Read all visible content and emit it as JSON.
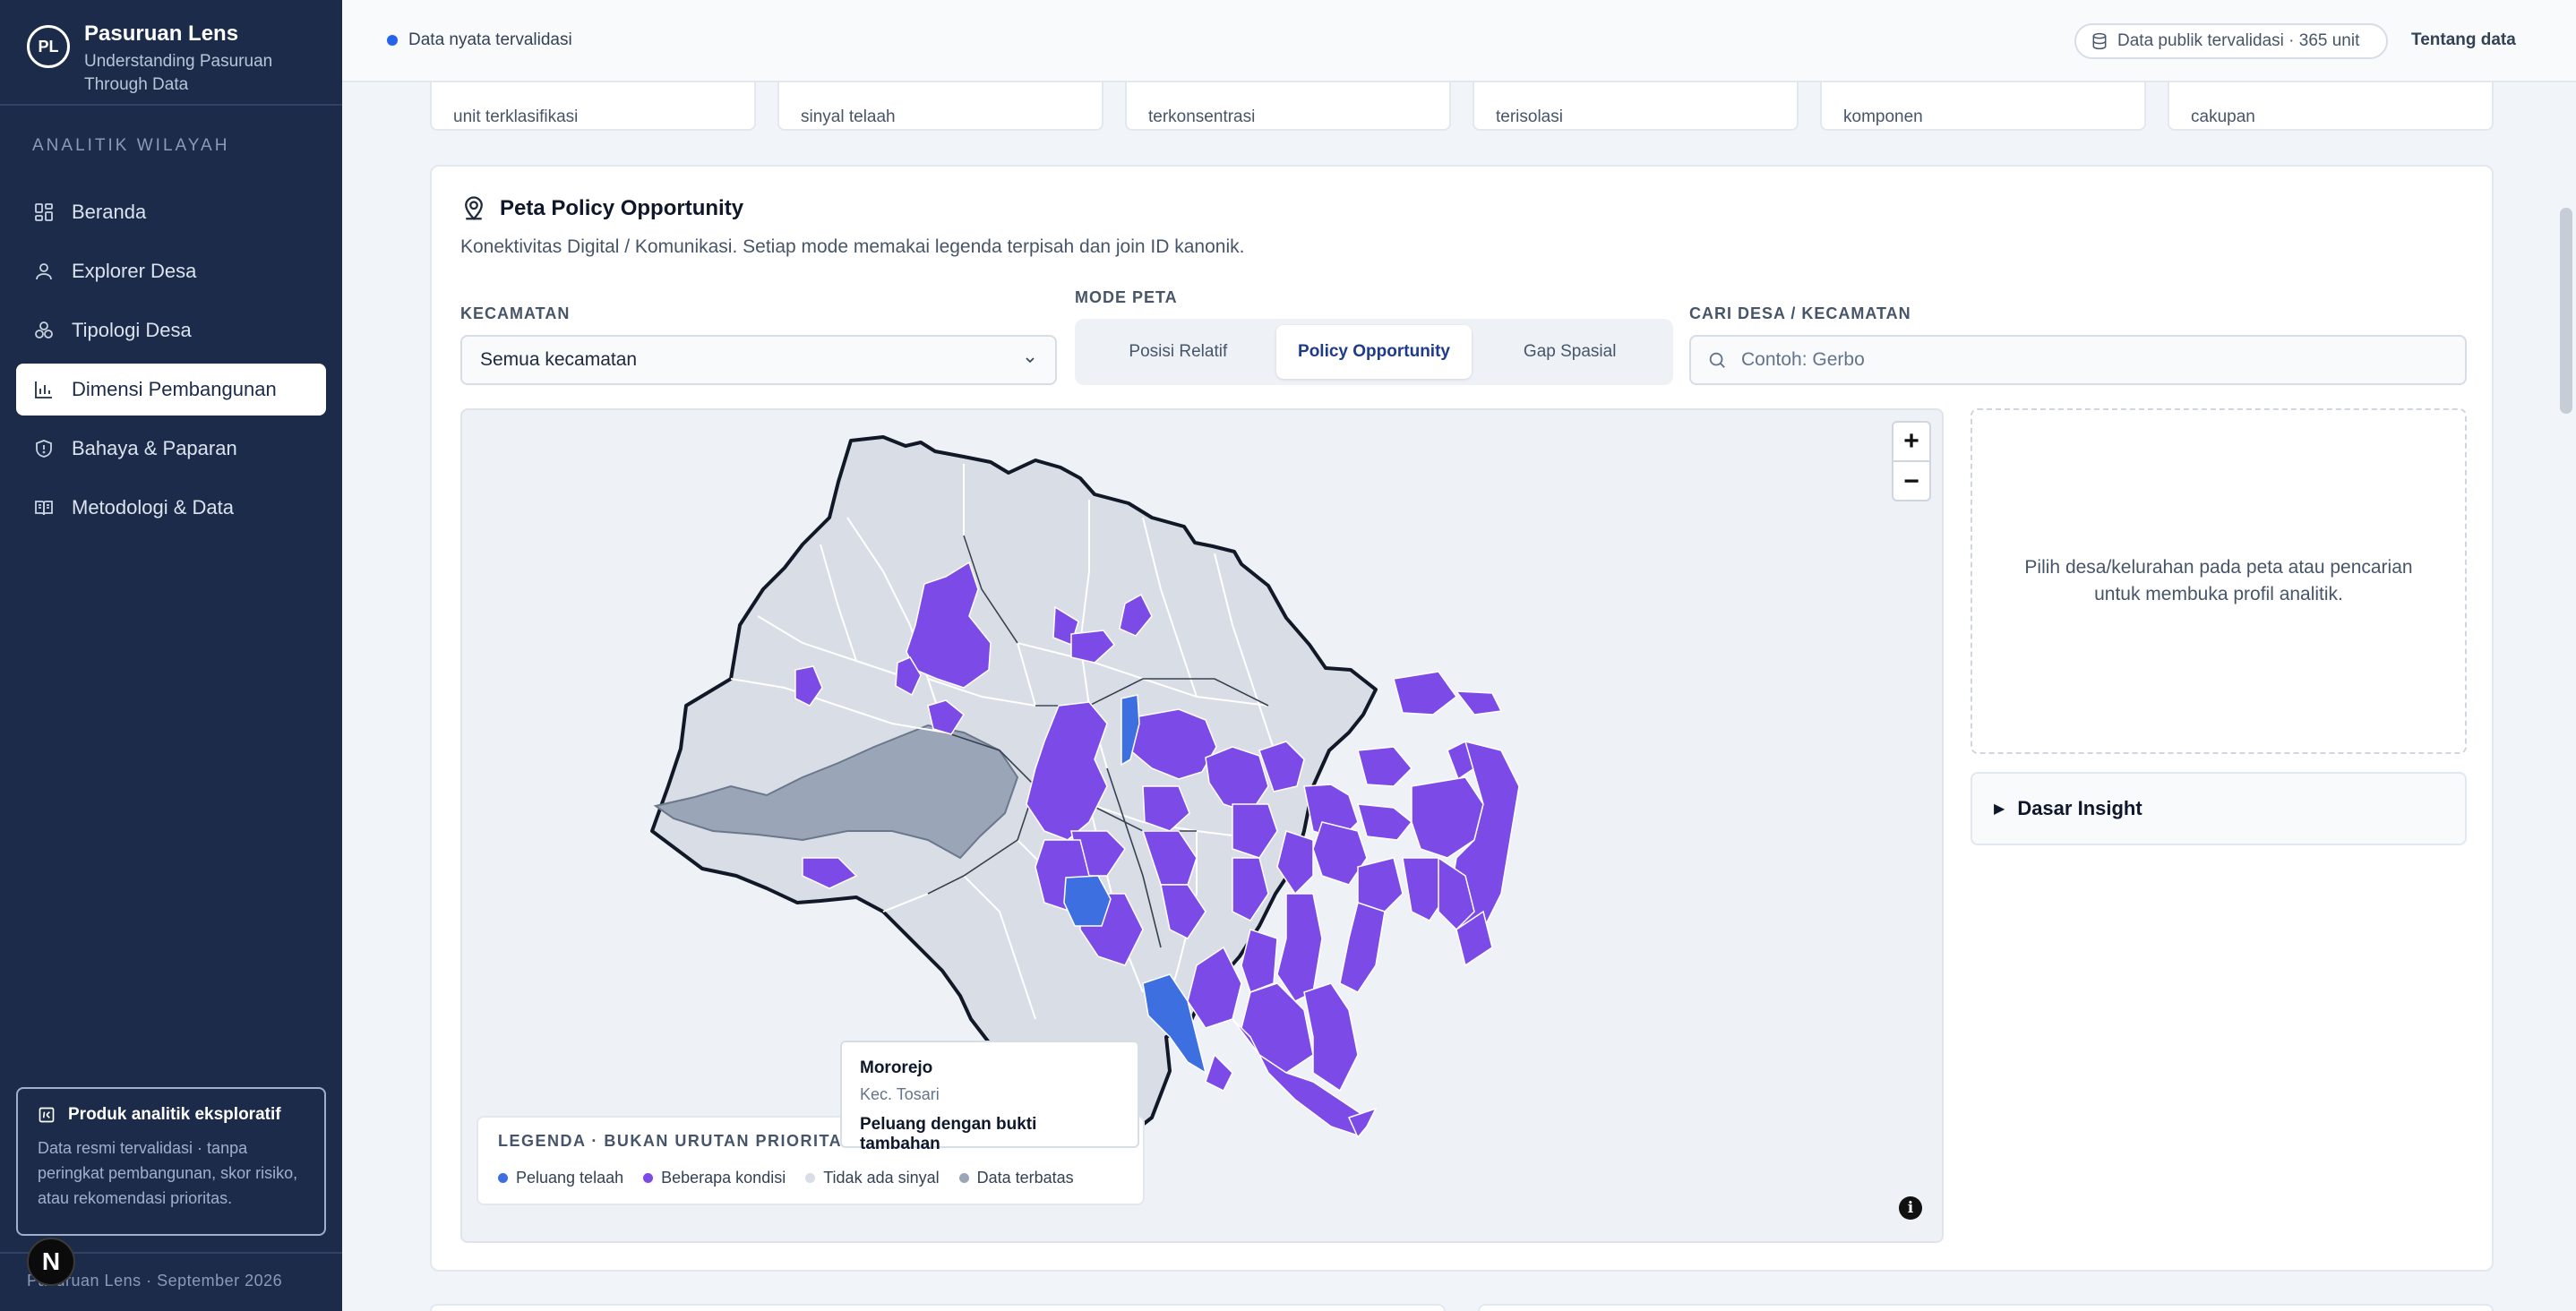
{
  "brand": {
    "logo": "PL",
    "title": "Pasuruan Lens",
    "subtitle": "Understanding Pasuruan Through Data"
  },
  "sidebar": {
    "section_label": "ANALITIK WILAYAH",
    "items": [
      {
        "label": "Beranda",
        "icon": "grid-icon",
        "active": false
      },
      {
        "label": "Explorer Desa",
        "icon": "user-icon",
        "active": false
      },
      {
        "label": "Tipologi Desa",
        "icon": "circles-icon",
        "active": false
      },
      {
        "label": "Dimensi Pembangunan",
        "icon": "bar-chart-icon",
        "active": true
      },
      {
        "label": "Bahaya & Paparan",
        "icon": "shield-icon",
        "active": false
      },
      {
        "label": "Metodologi & Data",
        "icon": "book-icon",
        "active": false
      }
    ],
    "promo": {
      "title": "Produk analitik eksploratif",
      "body": "Data resmi tervalidasi · tanpa peringkat pembangunan, skor risiko, atau rekomendasi prioritas."
    },
    "footer": "Pasuruan Lens · September 2026",
    "badge": "N"
  },
  "topbar": {
    "status": "Data nyata tervalidasi",
    "pill": "Data publik tervalidasi · 365 unit",
    "about": "Tentang data"
  },
  "kpis": [
    "unit terklasifikasi",
    "sinyal telaah",
    "terkonsentrasi",
    "terisolasi",
    "komponen",
    "cakupan"
  ],
  "panel": {
    "title": "Peta Policy Opportunity",
    "description": "Konektivitas Digital / Komunikasi. Setiap mode memakai legenda terpisah dan join ID kanonik.",
    "kecamatan_label": "KECAMATAN",
    "kecamatan_value": "Semua kecamatan",
    "mode_label": "MODE PETA",
    "modes": [
      {
        "label": "Posisi Relatif",
        "active": false
      },
      {
        "label": "Policy Opportunity",
        "active": true
      },
      {
        "label": "Gap Spasial",
        "active": false
      }
    ],
    "search_label": "CARI DESA / KECAMATAN",
    "search_placeholder": "Contoh: Gerbo"
  },
  "map": {
    "zoom_in": "+",
    "zoom_out": "−",
    "info": "i",
    "legend": {
      "title": "LEGENDA · BUKAN URUTAN PRIORITAS",
      "items": [
        {
          "label": "Peluang telaah",
          "color": "#3d6fe0"
        },
        {
          "label": "Beberapa kondisi",
          "color": "#7c4ae6"
        },
        {
          "label": "Tidak ada sinyal",
          "color": "#d9dde5"
        },
        {
          "label": "Data terbatas",
          "color": "#9aa6b8"
        }
      ]
    },
    "tooltip": {
      "name": "Mororejo",
      "kecamatan": "Kec. Tosari",
      "status": "Peluang dengan bukti tambahan"
    }
  },
  "profile": {
    "placeholder": "Pilih desa/kelurahan pada peta atau pencarian untuk membuka profil analitik."
  },
  "insight": {
    "label": "Dasar Insight"
  },
  "colors": {
    "sidebar_bg": "#1b2b49",
    "accent_blue": "#2563eb",
    "purple": "#7c4ae6",
    "blue_region": "#3d6fe0",
    "no_signal": "#d9dde5",
    "limited": "#9aa6b8"
  }
}
